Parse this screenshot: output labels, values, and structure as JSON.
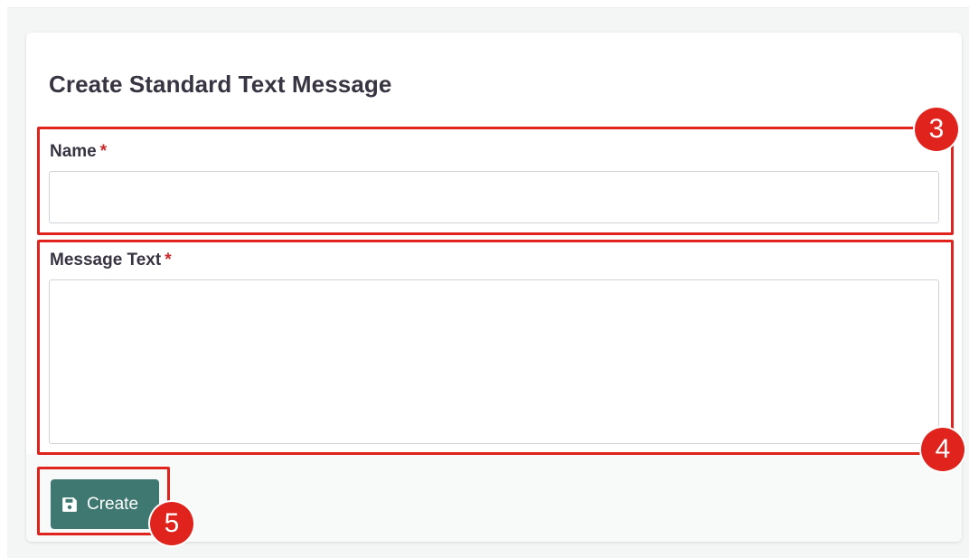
{
  "form": {
    "title": "Create Standard Text Message",
    "required_marker": "*",
    "name_field": {
      "label": "Name",
      "value": "",
      "placeholder": ""
    },
    "message_field": {
      "label": "Message Text",
      "value": "",
      "placeholder": ""
    },
    "create_button": {
      "label": "Create",
      "icon": "save-icon"
    }
  },
  "annotations": {
    "badge_3": "3",
    "badge_4": "4",
    "badge_5": "5"
  },
  "colors": {
    "primary_button": "#3f7870",
    "annotation_red": "#e0231c",
    "required_red": "#cc2a2a",
    "text_dark": "#383442"
  }
}
